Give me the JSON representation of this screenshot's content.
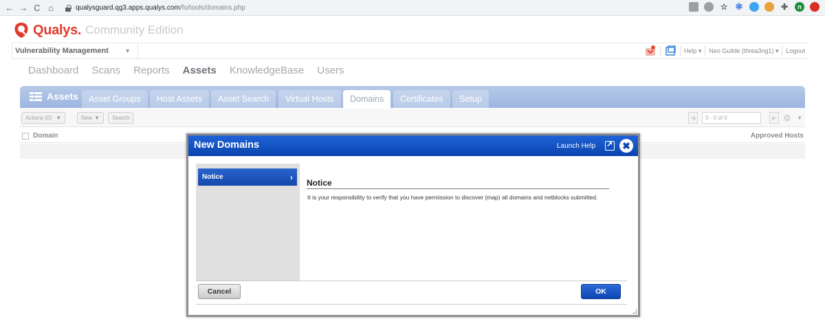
{
  "browser": {
    "url_host": "qualysguard.qg3.apps.qualys.com",
    "url_path": "/fo/tools/domains.php",
    "extension_avatar": "n"
  },
  "brand": {
    "name": "Qualys.",
    "edition": "Community Edition"
  },
  "module": {
    "selected": "Vulnerability Management"
  },
  "top_right": {
    "help": "Help",
    "user": "Neo Guilde (threa3ng1)",
    "logout": "Logout"
  },
  "main_nav": [
    "Dashboard",
    "Scans",
    "Reports",
    "Assets",
    "KnowledgeBase",
    "Users"
  ],
  "main_nav_active": "Assets",
  "assets": {
    "title": "Assets",
    "tabs": [
      "Asset Groups",
      "Host Assets",
      "Asset Search",
      "Virtual Hosts",
      "Domains",
      "Certificates",
      "Setup"
    ],
    "active_tab": "Domains"
  },
  "toolbar": {
    "actions": "Actions (0)",
    "new": "New",
    "search": "Search",
    "pager": "0 - 0 of 0"
  },
  "table": {
    "columns": [
      "Domain",
      "Approved Hosts"
    ]
  },
  "modal": {
    "title": "New Domains",
    "launch_help": "Launch Help",
    "sidebar_item": "Notice",
    "heading": "Notice",
    "text": "It is your responsibility to verify that you have permission to discover (map) all domains and netblocks submitted.",
    "cancel": "Cancel",
    "ok": "OK"
  },
  "colors": {
    "brand_red": "#e23a2c",
    "modal_blue": "#0c46b2",
    "tab_strip": "#a9c0e6"
  }
}
